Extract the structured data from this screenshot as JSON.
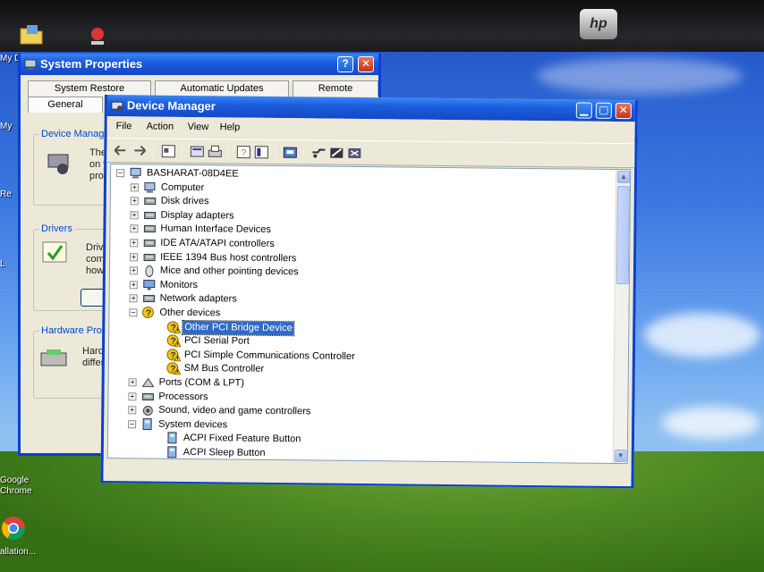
{
  "bezel": {
    "brand": "hp"
  },
  "desktop": {
    "icons": [
      {
        "label": "My D",
        "pos": "top-left"
      },
      {
        "label": "My",
        "pos": "left-1"
      },
      {
        "label": "Re",
        "pos": "left-2"
      },
      {
        "label": "L",
        "pos": "left-3"
      },
      {
        "label": "Google Chrome",
        "pos": "bottom-left"
      },
      {
        "label": "allation...",
        "pos": "bottom-left-2"
      }
    ]
  },
  "system_properties": {
    "title": "System Properties",
    "tabs_top": [
      "System Restore",
      "Automatic Updates",
      "Remote"
    ],
    "tabs_bottom": [
      "General",
      "",
      ""
    ],
    "groups": [
      {
        "title": "Device Manage",
        "text": [
          "The D",
          "on yo",
          "prope"
        ]
      },
      {
        "title": "Drivers",
        "text": [
          "Driver",
          "compa",
          "how V"
        ]
      },
      {
        "title": "Hardware Profile",
        "text": [
          "Hardw",
          "differe"
        ]
      }
    ]
  },
  "device_manager": {
    "title": "Device Manager",
    "menu": [
      "File",
      "Action",
      "View",
      "Help"
    ],
    "toolbar_icons": [
      "back-arrow-icon",
      "forward-arrow-icon",
      "properties-icon",
      "refresh-icon",
      "print-icon",
      "help-icon",
      "view-icon",
      "update-driver-icon",
      "uninstall-icon",
      "scan-hardware-icon",
      "disable-icon"
    ],
    "tree": [
      {
        "level": 0,
        "label": "BASHARAT-08D4EE",
        "icon": "computer-icon",
        "expander": "-"
      },
      {
        "level": 1,
        "label": "Computer",
        "icon": "computer-icon",
        "expander": "+"
      },
      {
        "level": 1,
        "label": "Disk drives",
        "icon": "disk-drive-icon",
        "expander": "+"
      },
      {
        "level": 1,
        "label": "Display adapters",
        "icon": "display-adapter-icon",
        "expander": "+"
      },
      {
        "level": 1,
        "label": "Human Interface Devices",
        "icon": "hid-icon",
        "expander": "+"
      },
      {
        "level": 1,
        "label": "IDE ATA/ATAPI controllers",
        "icon": "ide-controller-icon",
        "expander": "+"
      },
      {
        "level": 1,
        "label": "IEEE 1394 Bus host controllers",
        "icon": "ieee1394-icon",
        "expander": "+"
      },
      {
        "level": 1,
        "label": "Mice and other pointing devices",
        "icon": "mouse-icon",
        "expander": "+"
      },
      {
        "level": 1,
        "label": "Monitors",
        "icon": "monitor-icon",
        "expander": "+"
      },
      {
        "level": 1,
        "label": "Network adapters",
        "icon": "network-adapter-icon",
        "expander": "+"
      },
      {
        "level": 1,
        "label": "Other devices",
        "icon": "unknown-device-icon",
        "expander": "-"
      },
      {
        "level": 2,
        "label": "Other PCI Bridge Device",
        "icon": "warning-device-icon",
        "expander": "",
        "selected": true
      },
      {
        "level": 2,
        "label": "PCI Serial Port",
        "icon": "warning-device-icon",
        "expander": ""
      },
      {
        "level": 2,
        "label": "PCI Simple Communications Controller",
        "icon": "warning-device-icon",
        "expander": ""
      },
      {
        "level": 2,
        "label": "SM Bus Controller",
        "icon": "warning-device-icon",
        "expander": ""
      },
      {
        "level": 1,
        "label": "Ports (COM & LPT)",
        "icon": "port-icon",
        "expander": "+"
      },
      {
        "level": 1,
        "label": "Processors",
        "icon": "processor-icon",
        "expander": "+"
      },
      {
        "level": 1,
        "label": "Sound, video and game controllers",
        "icon": "sound-icon",
        "expander": "+"
      },
      {
        "level": 1,
        "label": "System devices",
        "icon": "system-device-icon",
        "expander": "-"
      },
      {
        "level": 2,
        "label": "ACPI Fixed Feature Button",
        "icon": "system-device-icon",
        "expander": ""
      },
      {
        "level": 2,
        "label": "ACPI Sleep Button",
        "icon": "system-device-icon",
        "expander": ""
      }
    ]
  },
  "colors": {
    "title_bar": "#1b5ddc",
    "selection": "#316ac5",
    "window_bg": "#ece9d8",
    "warning_yellow": "#f2c418"
  }
}
